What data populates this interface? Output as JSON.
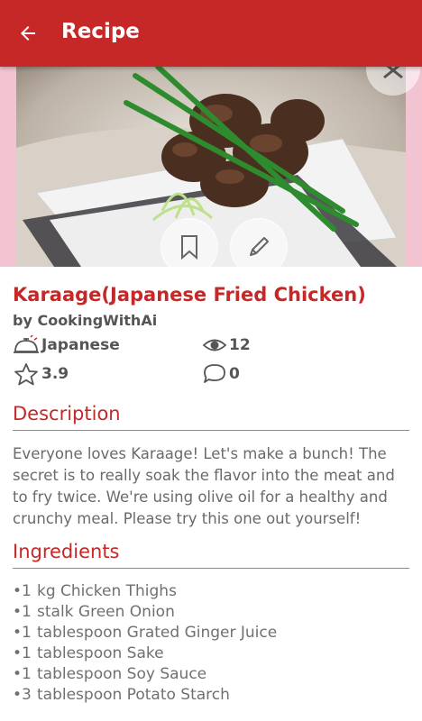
{
  "appbar": {
    "title": "Recipe"
  },
  "icons": {
    "back": "arrow-left-icon",
    "close": "close-icon",
    "bookmark": "bookmark-icon",
    "edit": "pencil-icon",
    "cuisine": "cloche-icon",
    "views": "eye-icon",
    "rating": "star-icon",
    "comments": "comment-icon"
  },
  "colors": {
    "primary": "#c62828",
    "text": "#555555"
  },
  "recipe": {
    "title": "Karaage(Japanese Fried Chicken)",
    "author": "by CookingWithAi",
    "cuisine": "Japanese",
    "views": "12",
    "rating": "3.9",
    "comments": "0"
  },
  "description": {
    "heading": "Description",
    "text": "Everyone loves Karaage! Let's make a bunch! The secret is to really soak the flavor into the meat and to fry twice. We're using olive oil for a healthy and crunchy meal. Please try this one out yourself!"
  },
  "ingredients": {
    "heading": "Ingredients",
    "items": [
      {
        "bullet": "•1",
        "text": "kg Chicken Thighs"
      },
      {
        "bullet": "•1",
        "text": "stalk Green Onion"
      },
      {
        "bullet": "•1",
        "text": "tablespoon Grated Ginger Juice"
      },
      {
        "bullet": "•1",
        "text": "tablespoon Sake"
      },
      {
        "bullet": "•1",
        "text": "tablespoon Soy Sauce"
      },
      {
        "bullet": "•3",
        "text": "tablespoon Potato Starch"
      }
    ]
  }
}
